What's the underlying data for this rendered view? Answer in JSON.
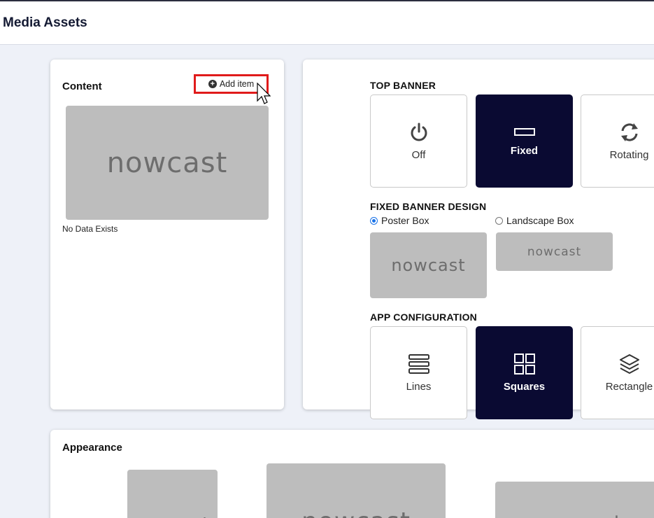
{
  "header": {
    "title": "Media Assets"
  },
  "content": {
    "title": "Content",
    "add_item_label": "Add item",
    "placeholder_logo": "nowcast",
    "empty_text": "No Data Exists"
  },
  "top_banner": {
    "title": "TOP BANNER",
    "options": [
      {
        "label": "Off",
        "icon": "power-icon",
        "selected": false
      },
      {
        "label": "Fixed",
        "icon": "rectangle-icon",
        "selected": true
      },
      {
        "label": "Rotating",
        "icon": "rotate-icon",
        "selected": false
      }
    ]
  },
  "fixed_banner_design": {
    "title": "FIXED BANNER DESIGN",
    "options": [
      {
        "label": "Poster Box",
        "selected": true
      },
      {
        "label": "Landscape Box",
        "selected": false
      }
    ],
    "logo": "nowcast"
  },
  "app_configuration": {
    "title": "APP CONFIGURATION",
    "options": [
      {
        "label": "Lines",
        "icon": "lines-icon",
        "selected": false
      },
      {
        "label": "Squares",
        "icon": "grid-icon",
        "selected": true
      },
      {
        "label": "Rectangle",
        "icon": "layers-icon",
        "selected": false
      }
    ]
  },
  "appearance": {
    "title": "Appearance",
    "logo": "nowcast"
  },
  "colors": {
    "selected_tile": "#0a0a32",
    "highlight_box": "#e01b1b",
    "placeholder_gray": "#bdbdbd"
  }
}
